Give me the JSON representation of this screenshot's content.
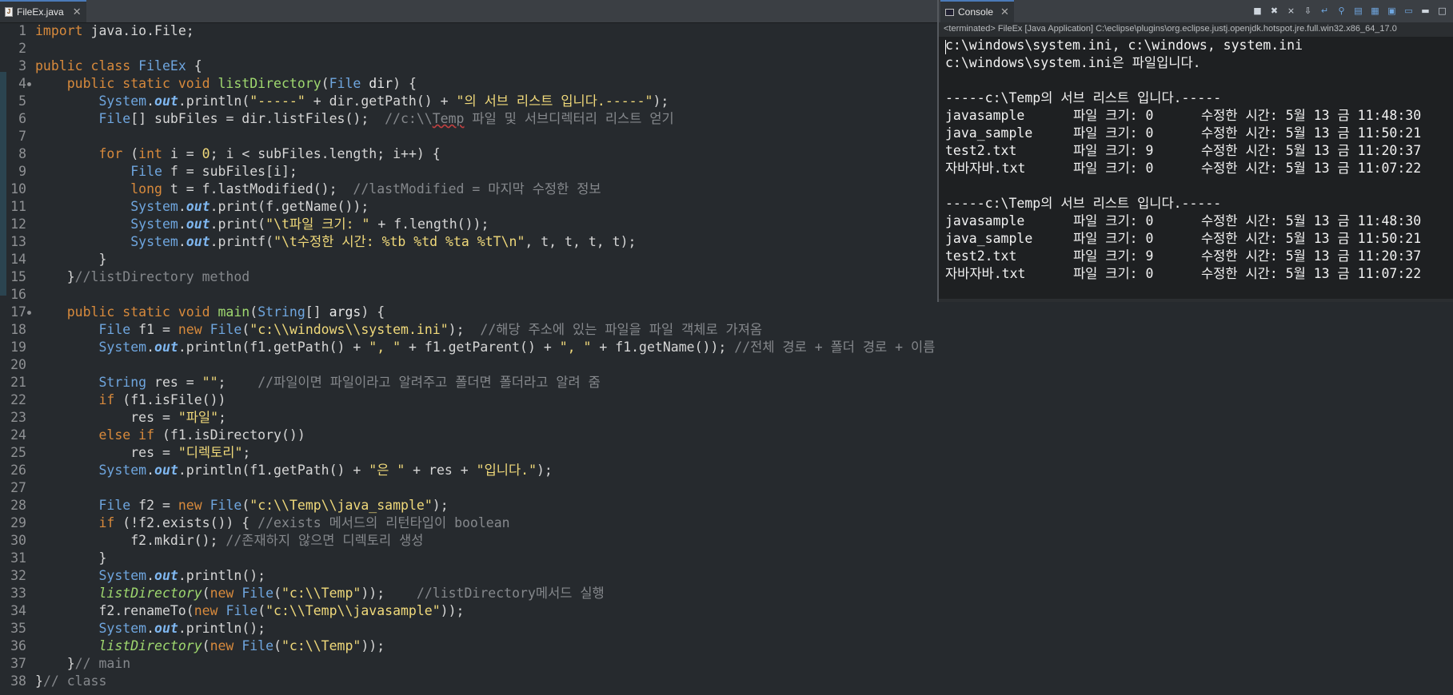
{
  "editor": {
    "tab_label": "FileEx.java",
    "tab_icon": "J",
    "close_glyph": "✕",
    "lines": [
      {
        "n": "1",
        "html": "<span class=\"kw\">import</span> java.io.File;"
      },
      {
        "n": "2",
        "html": ""
      },
      {
        "n": "3",
        "html": "<span class=\"kw\">public class</span> <span class=\"ty\">FileEx</span> {"
      },
      {
        "n": "4",
        "fold": true,
        "html": "    <span class=\"kw\">public static void</span> <span class=\"mfn\">listDirectory</span>(<span class=\"ty\">File</span> <span class=\"fd\">dir</span>) {"
      },
      {
        "n": "5",
        "html": "        <span class=\"ty\">System</span>.<span class=\"stf\">out</span>.println(<span class=\"st\">\"-----\"</span> + dir.getPath() + <span class=\"st\">\"의 서브 리스트 입니다.-----\"</span>);"
      },
      {
        "n": "6",
        "html": "        <span class=\"ty\">File</span>[] subFiles = dir.listFiles();  <span class=\"cm\">//c:\\\\<span class=\"uw\">Temp</span> 파일 및 서브디렉터리 리스트 얻기</span>"
      },
      {
        "n": "7",
        "html": ""
      },
      {
        "n": "8",
        "html": "        <span class=\"kw\">for</span> (<span class=\"kw\">int</span> i = <span class=\"st\">0</span>; i &lt; subFiles.length; i++) {"
      },
      {
        "n": "9",
        "html": "            <span class=\"ty\">File</span> f = subFiles[i];"
      },
      {
        "n": "10",
        "html": "            <span class=\"kw\">long</span> t = f.lastModified();  <span class=\"cm\">//lastModified = 마지막 수정한 정보</span>"
      },
      {
        "n": "11",
        "html": "            <span class=\"ty\">System</span>.<span class=\"stf\">out</span>.print(f.getName());"
      },
      {
        "n": "12",
        "html": "            <span class=\"ty\">System</span>.<span class=\"stf\">out</span>.print(<span class=\"st\">\"\\t파일 크기: \"</span> + f.length());"
      },
      {
        "n": "13",
        "html": "            <span class=\"ty\">System</span>.<span class=\"stf\">out</span>.printf(<span class=\"st\">\"\\t수정한 시간: %tb %td %ta %tT\\n\"</span>, t, t, t, t);"
      },
      {
        "n": "14",
        "html": "        }"
      },
      {
        "n": "15",
        "html": "    }<span class=\"cm\">//listDirectory method</span>"
      },
      {
        "n": "16",
        "html": ""
      },
      {
        "n": "17",
        "fold": true,
        "html": "    <span class=\"kw\">public static void</span> <span class=\"mfn\">main</span>(<span class=\"ty\">String</span>[] <span class=\"fd\">args</span>) {"
      },
      {
        "n": "18",
        "html": "        <span class=\"ty\">File</span> f1 = <span class=\"kw\">new</span> <span class=\"ty\">File</span>(<span class=\"st\">\"c:\\\\windows\\\\system.ini\"</span>);  <span class=\"cm\">//해당 주소에 있는 파일을 파일 객체로 가져옴</span>"
      },
      {
        "n": "19",
        "html": "        <span class=\"ty\">System</span>.<span class=\"stf\">out</span>.println(f1.getPath() + <span class=\"st\">\", \"</span> + f1.getParent() + <span class=\"st\">\", \"</span> + f1.getName()); <span class=\"cm\">//전체 경로 + 폴더 경로 + 이름</span>"
      },
      {
        "n": "20",
        "html": ""
      },
      {
        "n": "21",
        "html": "        <span class=\"ty\">String</span> res = <span class=\"st\">\"\"</span>;    <span class=\"cm\">//파일이면 파일이라고 알려주고 폴더면 폴더라고 알려 줌</span>"
      },
      {
        "n": "22",
        "html": "        <span class=\"kw\">if</span> (f1.isFile())"
      },
      {
        "n": "23",
        "html": "            res = <span class=\"st\">\"파일\"</span>;"
      },
      {
        "n": "24",
        "html": "        <span class=\"kw\">else if</span> (f1.isDirectory())"
      },
      {
        "n": "25",
        "html": "            res = <span class=\"st\">\"디렉토리\"</span>;"
      },
      {
        "n": "26",
        "html": "        <span class=\"ty\">System</span>.<span class=\"stf\">out</span>.println(f1.getPath() + <span class=\"st\">\"은 \"</span> + res + <span class=\"st\">\"입니다.\"</span>);"
      },
      {
        "n": "27",
        "html": ""
      },
      {
        "n": "28",
        "html": "        <span class=\"ty\">File</span> f2 = <span class=\"kw\">new</span> <span class=\"ty\">File</span>(<span class=\"st\">\"c:\\\\Temp\\\\java_sample\"</span>);"
      },
      {
        "n": "29",
        "html": "        <span class=\"kw\">if</span> (!f2.exists()) { <span class=\"cm\">//exists 메서드의 리턴타입이 boolean</span>"
      },
      {
        "n": "30",
        "html": "            f2.mkdir(); <span class=\"cm\">//존재하지 않으면 디렉토리 생성</span>"
      },
      {
        "n": "31",
        "html": "        }"
      },
      {
        "n": "32",
        "html": "        <span class=\"ty\">System</span>.<span class=\"stf\">out</span>.println();"
      },
      {
        "n": "33",
        "html": "        <span class=\"si\">listDirectory</span>(<span class=\"kw\">new</span> <span class=\"ty\">File</span>(<span class=\"st\">\"c:\\\\Temp\"</span>));    <span class=\"cm\">//listDirectory메서드 실행</span>"
      },
      {
        "n": "34",
        "html": "        f2.renameTo(<span class=\"kw\">new</span> <span class=\"ty\">File</span>(<span class=\"st\">\"c:\\\\Temp\\\\javasample\"</span>));"
      },
      {
        "n": "35",
        "html": "        <span class=\"ty\">System</span>.<span class=\"stf\">out</span>.println();"
      },
      {
        "n": "36",
        "html": "        <span class=\"si\">listDirectory</span>(<span class=\"kw\">new</span> <span class=\"ty\">File</span>(<span class=\"st\">\"c:\\\\Temp\"</span>));"
      },
      {
        "n": "37",
        "html": "    }<span class=\"cm\">// main</span>"
      },
      {
        "n": "38",
        "html": "}<span class=\"cm\">// class</span>"
      }
    ]
  },
  "console": {
    "tab_label": "Console",
    "close_glyph": "✕",
    "status": "<terminated> FileEx [Java Application] C:\\eclipse\\plugins\\org.eclipse.justj.openjdk.hotspot.jre.full.win32.x86_64_17.0",
    "toolbar_icons": [
      "terminate-icon",
      "remove-launch-icon",
      "remove-all-icon",
      "scroll-lock-icon",
      "word-wrap-icon",
      "pin-console-icon",
      "show-stdout-icon",
      "show-stderr-icon",
      "open-console-icon",
      "display-selected-console-icon",
      "minimize-icon",
      "maximize-icon"
    ],
    "toolbar_glyphs": [
      "■",
      "✖",
      "⨯",
      "⇩",
      "↵",
      "⚲",
      "▤",
      "▦",
      "▣",
      "▭",
      "▬",
      "□"
    ],
    "lines": [
      "c:\\windows\\system.ini, c:\\windows, system.ini",
      "c:\\windows\\system.ini은 파일입니다.",
      "",
      "-----c:\\Temp의 서브 리스트 입니다.-----"
    ],
    "listing1": [
      [
        "javasample",
        "파일 크기: 0",
        "수정한 시간: 5월 13 금 11:48:30"
      ],
      [
        "java_sample",
        "파일 크기: 0",
        "수정한 시간: 5월 13 금 11:50:21"
      ],
      [
        "test2.txt",
        "파일 크기: 9",
        "수정한 시간: 5월 13 금 11:20:37"
      ],
      [
        "자바자바.txt",
        "파일 크기: 0",
        "수정한 시간: 5월 13 금 11:07:22"
      ]
    ],
    "header2": "-----c:\\Temp의 서브 리스트 입니다.-----",
    "listing2": [
      [
        "javasample",
        "파일 크기: 0",
        "수정한 시간: 5월 13 금 11:48:30"
      ],
      [
        "java_sample",
        "파일 크기: 0",
        "수정한 시간: 5월 13 금 11:50:21"
      ],
      [
        "test2.txt",
        "파일 크기: 9",
        "수정한 시간: 5월 13 금 11:20:37"
      ],
      [
        "자바자바.txt",
        "파일 크기: 0",
        "수정한 시간: 5월 13 금 11:07:22"
      ]
    ]
  }
}
